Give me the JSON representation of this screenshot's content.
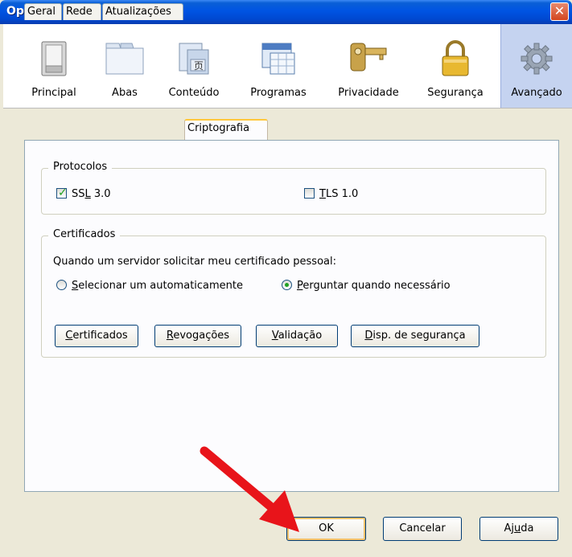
{
  "window": {
    "title": "Opções",
    "close_glyph": "✕"
  },
  "toolbar": {
    "items": [
      {
        "label": "Principal",
        "icon": "switch-icon"
      },
      {
        "label": "Abas",
        "icon": "tabs-icon"
      },
      {
        "label": "Conteúdo",
        "icon": "content-icon"
      },
      {
        "label": "Programas",
        "icon": "calendar-icon"
      },
      {
        "label": "Privacidade",
        "icon": "key-icon"
      },
      {
        "label": "Segurança",
        "icon": "lock-icon"
      },
      {
        "label": "Avançado",
        "icon": "gear-icon",
        "active": true
      }
    ]
  },
  "tabs": [
    {
      "label": "Geral"
    },
    {
      "label": "Rede"
    },
    {
      "label": "Atualizações"
    },
    {
      "label": "Criptografia",
      "active": true
    }
  ],
  "protocols": {
    "title": "Protocolos",
    "ssl_pre": "SS",
    "ssl_u": "L",
    "ssl_post": " 3.0",
    "ssl_checked": true,
    "tls_u": "T",
    "tls_post": "LS 1.0",
    "tls_checked": false
  },
  "certificates": {
    "title": "Certificados",
    "prompt": "Quando um servidor solicitar meu certificado pessoal:",
    "auto_u": "S",
    "auto_rest": "elecionar um automaticamente",
    "auto_selected": false,
    "ask_u": "P",
    "ask_rest": "erguntar quando necessário",
    "ask_selected": true,
    "buttons": {
      "certs_u": "C",
      "certs_rest": "ertificados",
      "revoke_u": "R",
      "revoke_rest": "evogações",
      "valid_u": "V",
      "valid_rest": "alidação",
      "devices_u": "D",
      "devices_rest": "isp. de segurança"
    }
  },
  "footer": {
    "ok": "OK",
    "cancel": "Cancelar",
    "help_pre": "Aj",
    "help_u": "u",
    "help_post": "da"
  },
  "colors": {
    "accent": "#0054e3",
    "annotation_arrow": "#e8141a"
  }
}
